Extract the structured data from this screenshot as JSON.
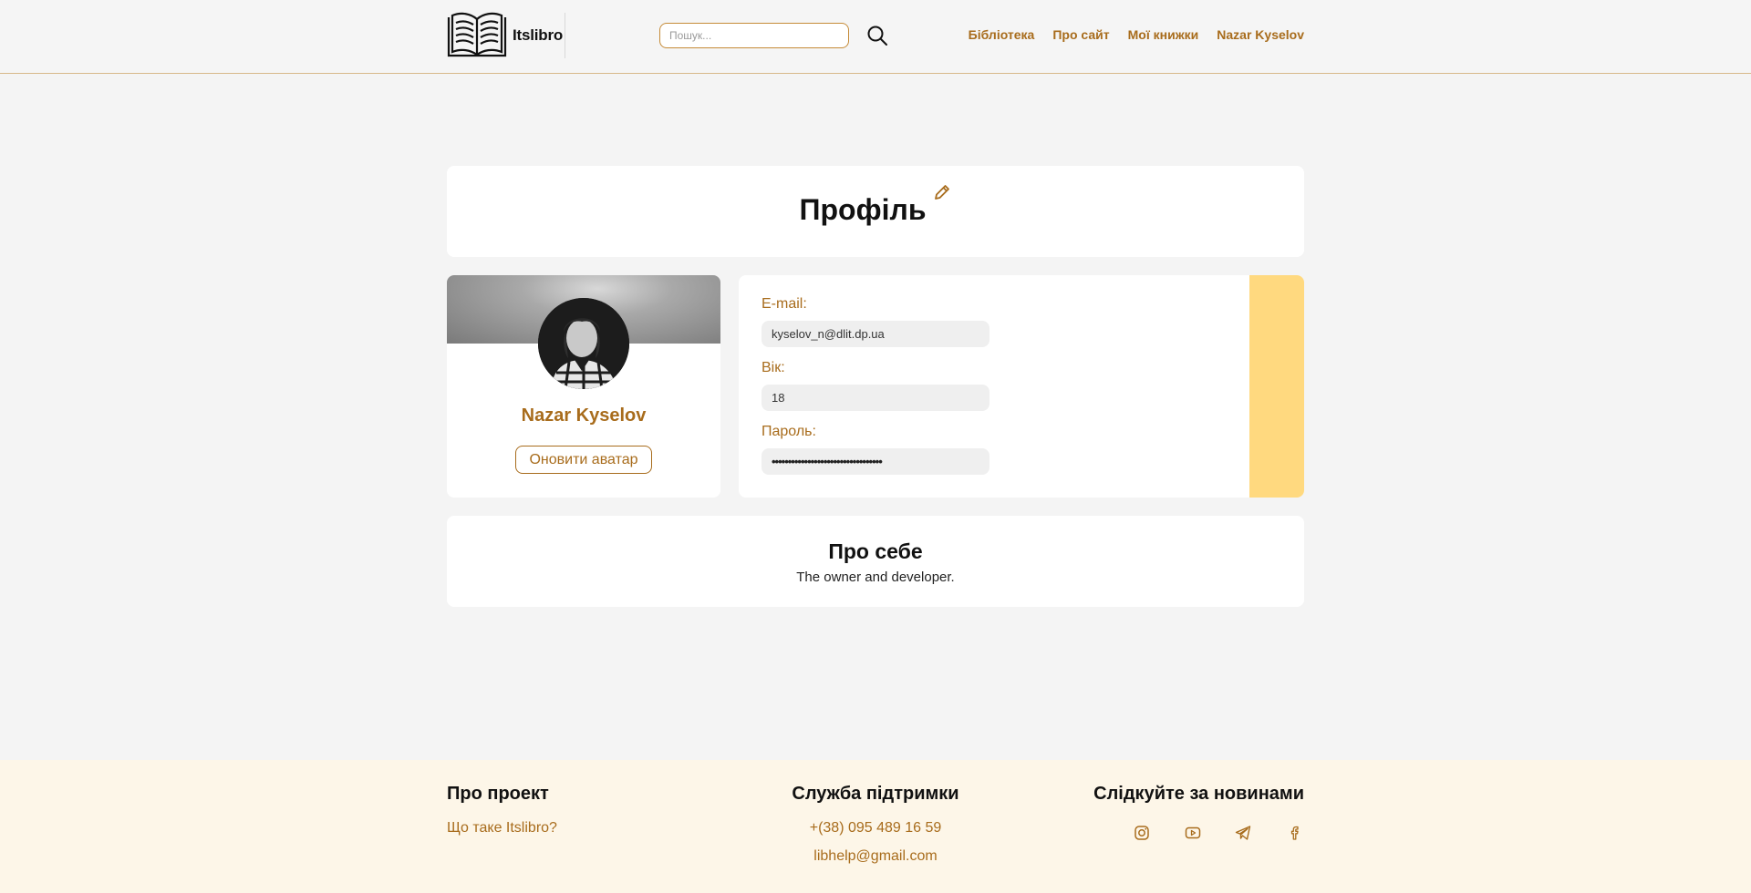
{
  "header": {
    "logo_text": "Itslibro",
    "search_placeholder": "Пошук...",
    "nav": [
      "Бібліотека",
      "Про сайт",
      "Мої книжки",
      "Nazar Kyselov"
    ]
  },
  "profile": {
    "title": "Профіль",
    "user_name": "Nazar Kyselov",
    "update_avatar_label": "Оновити аватар",
    "fields": {
      "email_label": "E-mail:",
      "email_value": "kyselov_n@dlit.dp.ua",
      "age_label": "Вік:",
      "age_value": "18",
      "password_label": "Пароль:",
      "password_value": "••••••••••••••••••••••••••••••••••"
    },
    "about_title": "Про себе",
    "about_text": "The owner and developer."
  },
  "footer": {
    "col1_title": "Про проект",
    "col1_link": "Що таке Itslibro?",
    "col2_title": "Служба підтримки",
    "phone": "+(38) 095 489 16 59",
    "email": "libhelp@gmail.com",
    "col3_title": "Слідкуйте за новинами",
    "social_icons": [
      "instagram-icon",
      "youtube-icon",
      "telegram-icon",
      "facebook-icon"
    ]
  },
  "colors": {
    "accent": "#a86c1c",
    "stripe": "#ffd97f",
    "footer_bg": "#fdf6e8",
    "page_bg": "#f4f4f4"
  }
}
